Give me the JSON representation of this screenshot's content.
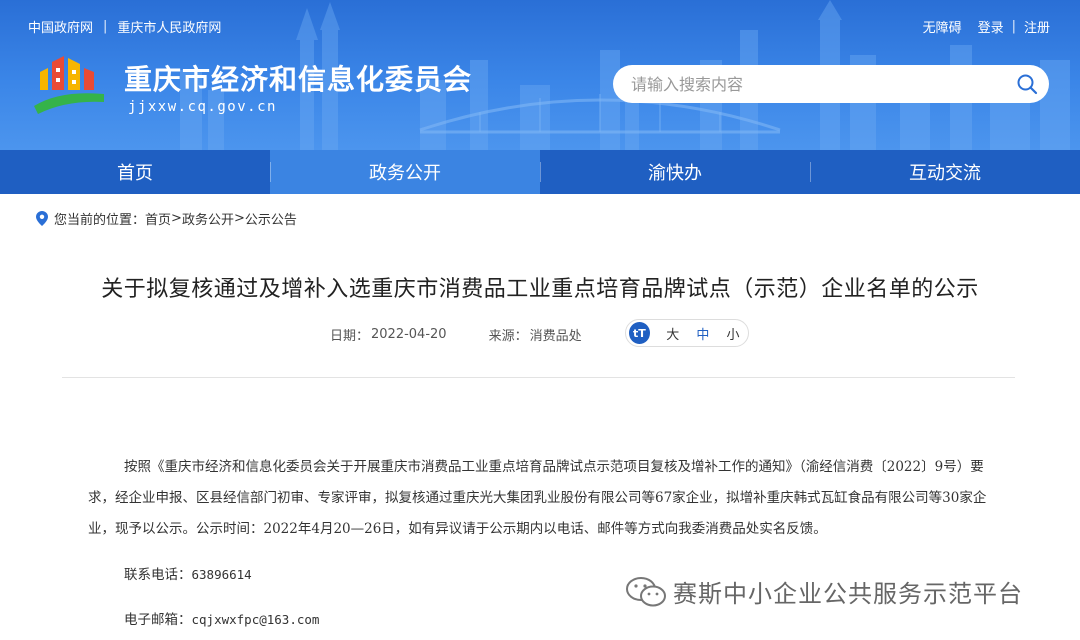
{
  "header": {
    "top_links": [
      "中国政府网",
      "重庆市人民政府网"
    ],
    "right_links": [
      "无障碍",
      "登录",
      "注册"
    ],
    "site_title": "重庆市经济和信息化委员会",
    "site_domain": "jjxxw.cq.gov.cn",
    "search_placeholder": "请输入搜索内容"
  },
  "nav": {
    "items": [
      "首页",
      "政务公开",
      "渝快办",
      "互动交流"
    ],
    "active": "政务公开"
  },
  "breadcrumb": {
    "prefix": "您当前的位置：",
    "home": "首页",
    "sep1": " >",
    "level1": "政务公开",
    "sep2": " >",
    "level2": "公示公告"
  },
  "article": {
    "title": "关于拟复核通过及增补入选重庆市消费品工业重点培育品牌试点（示范）企业名单的公示",
    "date_label": "日期：",
    "date": "2022-04-20",
    "source_label": "来源：",
    "source": "消费品处",
    "font_sizes": [
      "大",
      "中",
      "小"
    ],
    "body": "按照《重庆市经济和信息化委员会关于开展重庆市消费品工业重点培育品牌试点示范项目复核及增补工作的通知》（渝经信消费〔2022〕9号）要求，经企业申报、区县经信部门初审、专家评审，拟复核通过重庆光大集团乳业股份有限公司等67家企业，拟增补重庆韩式瓦缸食品有限公司等30家企业，现予以公示。公示时间：2022年4月20—26日，如有异议请于公示期内以电话、邮件等方式向我委消费品处实名反馈。",
    "phone_label": "联系电话：",
    "phone": "63896614",
    "email_label": "电子邮箱：",
    "email": "cqjxwxfpc@163.com"
  },
  "watermark": {
    "text": "赛斯中小企业公共服务示范平台"
  },
  "colors": {
    "header_blue": "#2a6fd6",
    "nav_blue": "#1f5fc2",
    "nav_active": "#3b84e2"
  }
}
